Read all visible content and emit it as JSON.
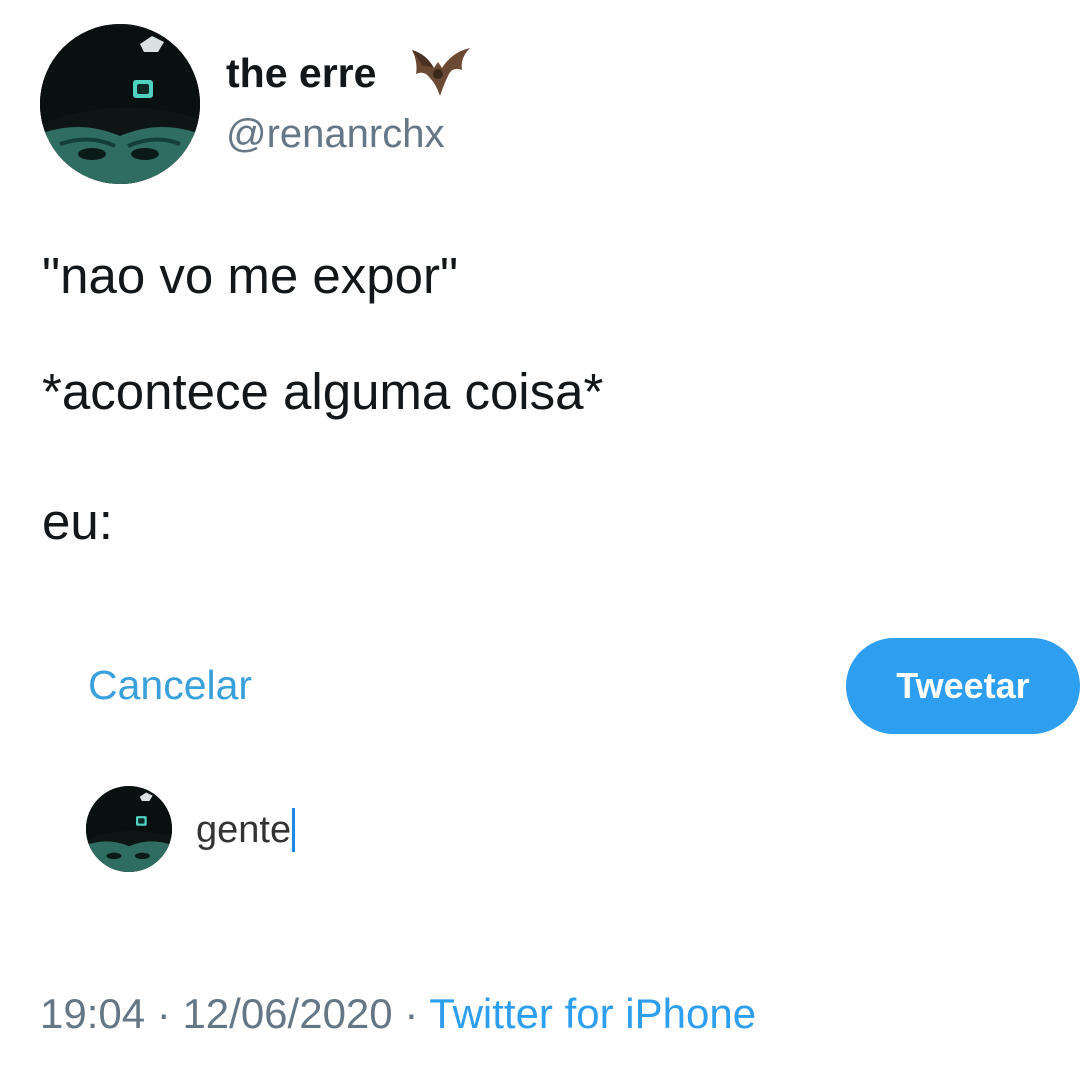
{
  "user": {
    "display_name": "the erre",
    "name_emoji_icon": "bat-icon",
    "handle": "@renanrchx"
  },
  "tweet": {
    "lines": [
      "\"nao vo me expor\"",
      "*acontece alguma coisa*",
      "eu:"
    ]
  },
  "composer": {
    "cancel_label": "Cancelar",
    "tweet_label": "Tweetar",
    "draft_text": "gente"
  },
  "meta": {
    "time": "19:04",
    "separator": " · ",
    "date": "12/06/2020",
    "source": "Twitter for iPhone"
  },
  "colors": {
    "link_blue": "#3aa0dc",
    "button_blue": "#2d9ef0",
    "secondary_gray": "#657786"
  }
}
